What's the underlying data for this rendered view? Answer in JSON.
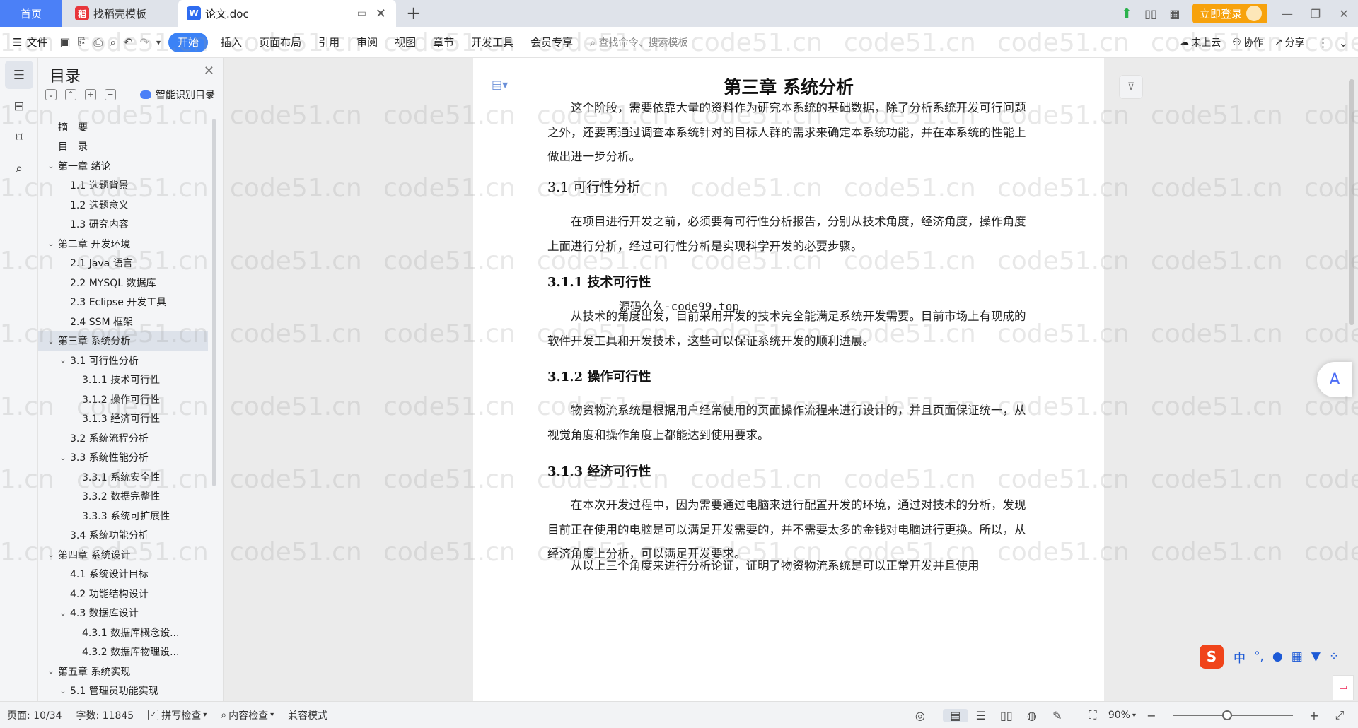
{
  "tabs": {
    "home": "首页",
    "template": "找稻壳模板",
    "doc": "论文.doc"
  },
  "top_right": {
    "login": "立即登录"
  },
  "ribbon": {
    "file": "文件",
    "tabs": [
      "开始",
      "插入",
      "页面布局",
      "引用",
      "审阅",
      "视图",
      "章节",
      "开发工具",
      "会员专享"
    ],
    "search": "查找命令、搜索模板",
    "cloud": "未上云",
    "collab": "协作",
    "share": "分享"
  },
  "toc": {
    "title": "目录",
    "smart": "智能识别目录",
    "items": [
      {
        "label": "摘　要",
        "level": 0,
        "caret": ""
      },
      {
        "label": "目　录",
        "level": 0,
        "caret": ""
      },
      {
        "label": "第一章 绪论",
        "level": 0,
        "caret": "v"
      },
      {
        "label": "1.1 选题背景",
        "level": 1,
        "caret": ""
      },
      {
        "label": "1.2 选题意义",
        "level": 1,
        "caret": ""
      },
      {
        "label": "1.3 研究内容",
        "level": 1,
        "caret": ""
      },
      {
        "label": "第二章 开发环境",
        "level": 0,
        "caret": "v"
      },
      {
        "label": "2.1 Java 语言",
        "level": 1,
        "caret": ""
      },
      {
        "label": "2.2 MYSQL 数据库",
        "level": 1,
        "caret": ""
      },
      {
        "label": "2.3 Eclipse 开发工具",
        "level": 1,
        "caret": ""
      },
      {
        "label": "2.4 SSM 框架",
        "level": 1,
        "caret": ""
      },
      {
        "label": "第三章 系统分析",
        "level": 0,
        "caret": "v",
        "selected": true
      },
      {
        "label": "3.1 可行性分析",
        "level": 1,
        "caret": "v"
      },
      {
        "label": "3.1.1 技术可行性",
        "level": 2,
        "caret": ""
      },
      {
        "label": "3.1.2 操作可行性",
        "level": 2,
        "caret": ""
      },
      {
        "label": "3.1.3 经济可行性",
        "level": 2,
        "caret": ""
      },
      {
        "label": "3.2 系统流程分析",
        "level": 1,
        "caret": ""
      },
      {
        "label": "3.3 系统性能分析",
        "level": 1,
        "caret": "v"
      },
      {
        "label": "3.3.1 系统安全性",
        "level": 2,
        "caret": ""
      },
      {
        "label": "3.3.2 数据完整性",
        "level": 2,
        "caret": ""
      },
      {
        "label": "3.3.3 系统可扩展性",
        "level": 2,
        "caret": ""
      },
      {
        "label": "3.4 系统功能分析",
        "level": 1,
        "caret": ""
      },
      {
        "label": "第四章 系统设计",
        "level": 0,
        "caret": "v"
      },
      {
        "label": "4.1 系统设计目标",
        "level": 1,
        "caret": ""
      },
      {
        "label": "4.2 功能结构设计",
        "level": 1,
        "caret": ""
      },
      {
        "label": "4.3 数据库设计",
        "level": 1,
        "caret": "v"
      },
      {
        "label": "4.3.1 数据库概念设...",
        "level": 2,
        "caret": ""
      },
      {
        "label": "4.3.2 数据库物理设...",
        "level": 2,
        "caret": ""
      },
      {
        "label": "第五章 系统实现",
        "level": 0,
        "caret": "v"
      },
      {
        "label": "5.1 管理员功能实现",
        "level": 1,
        "caret": "v"
      }
    ]
  },
  "document": {
    "chapter_title": "第三章 系统分析",
    "intro": "这个阶段，需要依靠大量的资料作为研究本系统的基础数据，除了分析系统开发可行问题之外，还要再通过调查本系统针对的目标人群的需求来确定本系统功能，并在本系统的性能上做出进一步分析。",
    "h_31": "3.1 可行性分析",
    "p_31": "在项目进行开发之前，必须要有可行性分析报告，分别从技术角度，经济角度，操作角度上面进行分析，经过可行性分析是实现科学开发的必要步骤。",
    "h_311": "3.1.1 技术可行性",
    "code_note": "源码久久-code99.top",
    "p_311": "从技术的角度出发，目前采用开发的技术完全能满足系统开发需要。目前市场上有现成的软件开发工具和开发技术，这些可以保证系统开发的顺利进展。",
    "h_312": "3.1.2 操作可行性",
    "p_312": "物资物流系统是根据用户经常使用的页面操作流程来进行设计的，并且页面保证统一，从视觉角度和操作角度上都能达到使用要求。",
    "h_313": "3.1.3 经济可行性",
    "p_313": "在本次开发过程中，因为需要通过电脑来进行配置开发的环境，通过对技术的分析，发现目前正在使用的电脑是可以满足开发需要的，并不需要太多的金钱对电脑进行更换。所以，从经济角度上分析，可以满足开发要求。",
    "p_last": "从以上三个角度来进行分析论证，证明了物资物流系统是可以正常开发并且使用"
  },
  "watermark": "code51.cn",
  "ime": {
    "logo": "S",
    "lang": "中"
  },
  "status": {
    "page": "页面: 10/34",
    "words": "字数: 11845",
    "spell": "拼写检查",
    "content": "内容检查",
    "compat": "兼容模式",
    "zoom": "90%",
    "zoom_level": 0.45
  },
  "colors": {
    "accent": "#3b82f6",
    "home_tab": "#4b80f7",
    "login": "#f7a20c"
  }
}
